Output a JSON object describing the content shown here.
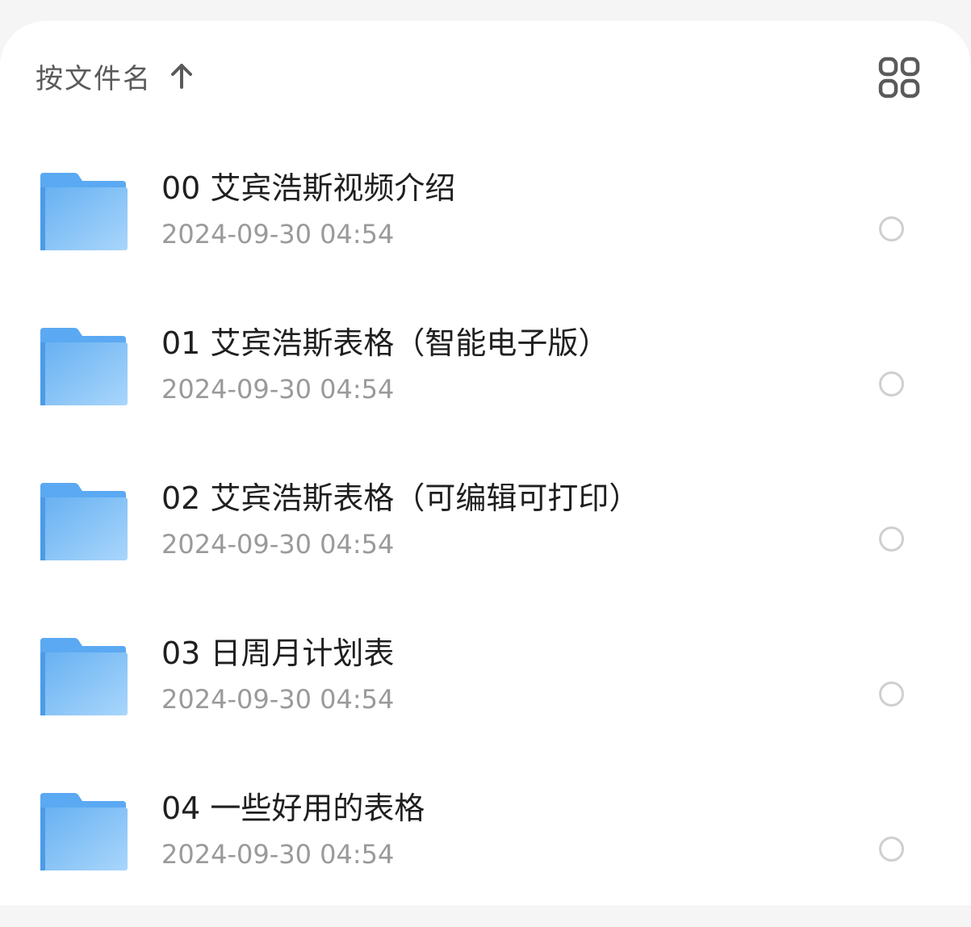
{
  "sort": {
    "label": "按文件名",
    "direction_icon": "arrow-up-icon"
  },
  "view_toggle": {
    "icon": "grid-view-icon",
    "color": "#5a5a5a"
  },
  "folder_color": "#5aa9f2",
  "files": [
    {
      "name": "00 艾宾浩斯视频介绍",
      "date": "2024-09-30 04:54",
      "icon": "folder-icon",
      "selected": false
    },
    {
      "name": "01 艾宾浩斯表格（智能电子版）",
      "date": "2024-09-30 04:54",
      "icon": "folder-icon",
      "selected": false
    },
    {
      "name": "02 艾宾浩斯表格（可编辑可打印）",
      "date": "2024-09-30 04:54",
      "icon": "folder-icon",
      "selected": false
    },
    {
      "name": "03 日周月计划表",
      "date": "2024-09-30 04:54",
      "icon": "folder-icon",
      "selected": false
    },
    {
      "name": "04 一些好用的表格",
      "date": "2024-09-30 04:54",
      "icon": "folder-icon",
      "selected": false
    }
  ]
}
